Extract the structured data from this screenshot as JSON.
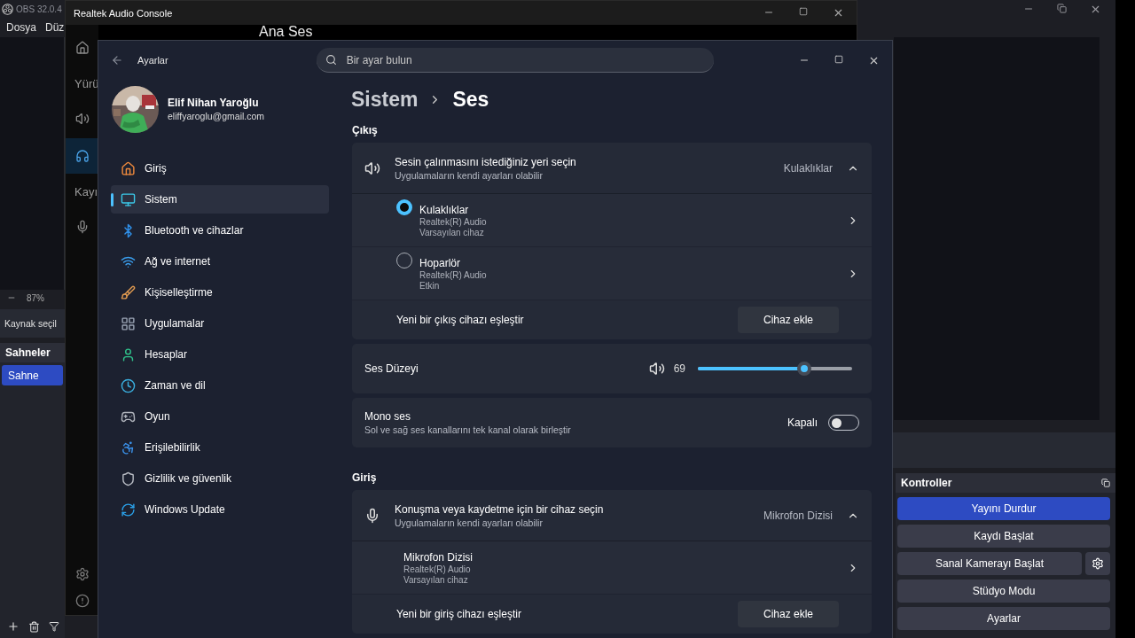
{
  "obs": {
    "title": "OBS 32.0.4",
    "menu": [
      "Dosya",
      "Düz"
    ],
    "zoom": "87%",
    "source_bar": "Kaynak seçil",
    "scenes": {
      "title": "Sahneler",
      "items": [
        {
          "label": "Sahne",
          "selected": true
        }
      ]
    },
    "controls": {
      "title": "Kontroller",
      "buttons": [
        {
          "label": "Yayını Durdur",
          "active": true,
          "gear": false
        },
        {
          "label": "Kaydı Başlat",
          "active": false,
          "gear": false
        },
        {
          "label": "Sanal Kamerayı Başlat",
          "active": false,
          "gear": true
        },
        {
          "label": "Stüdyo Modu",
          "active": false,
          "gear": false
        },
        {
          "label": "Ayarlar",
          "active": false,
          "gear": false
        }
      ]
    }
  },
  "realtek": {
    "title": "Realtek Audio Console",
    "heading": "Ana Ses",
    "rail": [
      {
        "kind": "icon",
        "selected": false
      },
      {
        "kind": "label",
        "text": "Yürü"
      },
      {
        "kind": "icon",
        "selected": false
      },
      {
        "kind": "icon",
        "selected": true
      },
      {
        "kind": "label",
        "text": "Kayı"
      },
      {
        "kind": "icon",
        "selected": false
      }
    ]
  },
  "settings": {
    "title": "Ayarlar",
    "search": {
      "placeholder": "Bir ayar bulun"
    },
    "user": {
      "name": "Elif Nihan Yaroğlu",
      "email": "eliffyaroglu@gmail.com"
    },
    "nav": [
      {
        "label": "Giriş",
        "selected": false
      },
      {
        "label": "Sistem",
        "selected": true
      },
      {
        "label": "Bluetooth ve cihazlar",
        "selected": false
      },
      {
        "label": "Ağ ve internet",
        "selected": false
      },
      {
        "label": "Kişiselleştirme",
        "selected": false
      },
      {
        "label": "Uygulamalar",
        "selected": false
      },
      {
        "label": "Hesaplar",
        "selected": false
      },
      {
        "label": "Zaman ve dil",
        "selected": false
      },
      {
        "label": "Oyun",
        "selected": false
      },
      {
        "label": "Erişilebilirlik",
        "selected": false
      },
      {
        "label": "Gizlilik ve güvenlik",
        "selected": false
      },
      {
        "label": "Windows Update",
        "selected": false
      }
    ],
    "breadcrumb": {
      "parent": "Sistem",
      "current": "Ses"
    },
    "output": {
      "heading": "Çıkış",
      "title": "Sesin çalınmasını istediğiniz yeri seçin",
      "subtitle": "Uygulamaların kendi ayarları olabilir",
      "value": "Kulaklıklar",
      "expanded": true,
      "devices": [
        {
          "kind": "radio",
          "name": "Kulaklıklar",
          "driver": "Realtek(R) Audio",
          "status": "Varsayılan cihaz",
          "selected": true
        },
        {
          "kind": "radio",
          "name": "Hoparlör",
          "driver": "Realtek(R) Audio",
          "status": "Etkin",
          "selected": false
        }
      ],
      "pair": {
        "label": "Yeni bir çıkış cihazı eşleştir",
        "button": "Cihaz ekle"
      }
    },
    "volume": {
      "label": "Ses Düzeyi",
      "reading": "69",
      "level": 0.69
    },
    "mono": {
      "title": "Mono ses",
      "subtitle": "Sol ve sağ ses kanallarını tek kanal olarak birleştir",
      "state": "Kapalı",
      "on": false
    },
    "input": {
      "heading": "Giriş",
      "title": "Konuşma veya kaydetme için bir cihaz seçin",
      "subtitle": "Uygulamaların kendi ayarları olabilir",
      "value": "Mikrofon Dizisi",
      "expanded": true,
      "devices": [
        {
          "kind": "plain",
          "name": "Mikrofon Dizisi",
          "driver": "Realtek(R) Audio",
          "status": "Varsayılan cihaz"
        }
      ],
      "pair": {
        "label": "Yeni bir giriş cihazı eşleştir",
        "button": "Cihaz ekle"
      }
    }
  }
}
